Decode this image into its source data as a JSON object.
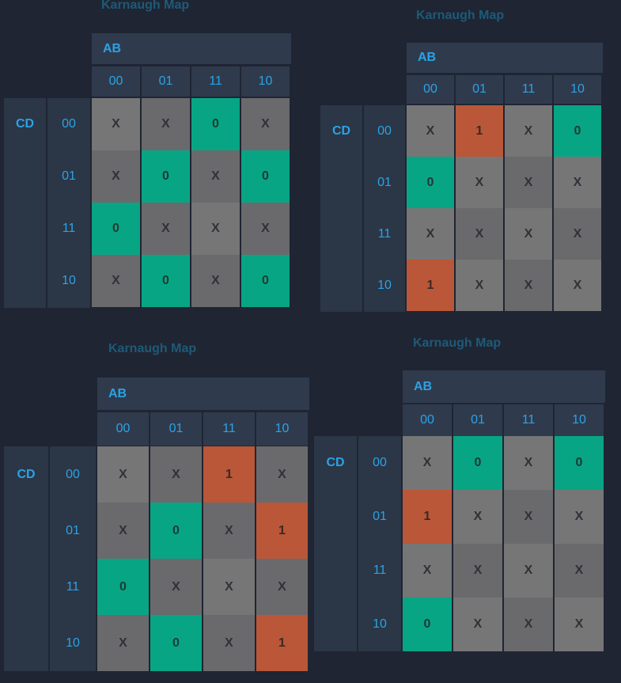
{
  "maps": [
    {
      "title": "Karnaugh Map",
      "ab_label": "AB",
      "cd_label": "CD",
      "columns": [
        "00",
        "01",
        "11",
        "10"
      ],
      "rows": [
        {
          "label": "00",
          "cells": [
            "X",
            "X",
            "0",
            "X"
          ]
        },
        {
          "label": "01",
          "cells": [
            "X",
            "0",
            "X",
            "0"
          ]
        },
        {
          "label": "11",
          "cells": [
            "0",
            "X",
            "X",
            "X"
          ]
        },
        {
          "label": "10",
          "cells": [
            "X",
            "0",
            "X",
            "0"
          ]
        }
      ]
    },
    {
      "title": "Karnaugh Map",
      "ab_label": "AB",
      "cd_label": "CD",
      "columns": [
        "00",
        "01",
        "11",
        "10"
      ],
      "rows": [
        {
          "label": "00",
          "cells": [
            "X",
            "1",
            "X",
            "0"
          ]
        },
        {
          "label": "01",
          "cells": [
            "0",
            "X",
            "X",
            "X"
          ]
        },
        {
          "label": "11",
          "cells": [
            "X",
            "X",
            "X",
            "X"
          ]
        },
        {
          "label": "10",
          "cells": [
            "1",
            "X",
            "X",
            "X"
          ]
        }
      ]
    },
    {
      "title": "Karnaugh Map",
      "ab_label": "AB",
      "cd_label": "CD",
      "columns": [
        "00",
        "01",
        "11",
        "10"
      ],
      "rows": [
        {
          "label": "00",
          "cells": [
            "X",
            "X",
            "1",
            "X"
          ]
        },
        {
          "label": "01",
          "cells": [
            "X",
            "0",
            "X",
            "1"
          ]
        },
        {
          "label": "11",
          "cells": [
            "0",
            "X",
            "X",
            "X"
          ]
        },
        {
          "label": "10",
          "cells": [
            "X",
            "0",
            "X",
            "1"
          ]
        }
      ]
    },
    {
      "title": "Karnaugh Map",
      "ab_label": "AB",
      "cd_label": "CD",
      "columns": [
        "00",
        "01",
        "11",
        "10"
      ],
      "rows": [
        {
          "label": "00",
          "cells": [
            "X",
            "0",
            "X",
            "0"
          ]
        },
        {
          "label": "01",
          "cells": [
            "1",
            "X",
            "X",
            "X"
          ]
        },
        {
          "label": "11",
          "cells": [
            "X",
            "X",
            "X",
            "X"
          ]
        },
        {
          "label": "10",
          "cells": [
            "0",
            "X",
            "X",
            "X"
          ]
        }
      ]
    }
  ],
  "colors": {
    "background": "#1f2533",
    "header": "#2f3b4d",
    "label_blue": "#2aa3e6",
    "title": "#1e5d7c",
    "cell_x": "#6a6a6c",
    "cell_zero": "#08a585",
    "cell_one": "#b95738"
  }
}
